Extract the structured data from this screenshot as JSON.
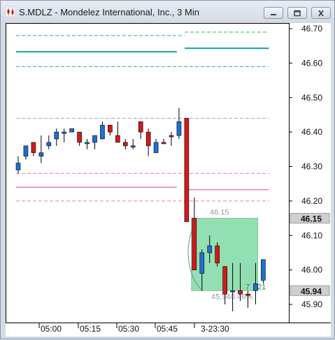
{
  "window": {
    "title": "S.MDLZ - Mondelez International, Inc., 3 Min",
    "icon": "candlestick-chart-icon",
    "buttons": [
      "minimize-icon",
      "maximize-icon",
      "close-icon"
    ]
  },
  "chart_data": {
    "type": "candlestick",
    "title": "S.MDLZ - Mondelez International, Inc., 3 Min",
    "y_ticks": [
      "46.70",
      "46.60",
      "46.50",
      "46.40",
      "46.30",
      "46.20",
      "46.10",
      "46.00",
      "45.90"
    ],
    "ylim": [
      45.86,
      46.72
    ],
    "x_ticks": [
      "05:00",
      "05:15",
      "05:30",
      "05:45",
      "3-23:30"
    ],
    "price_tags": [
      {
        "value": 46.15,
        "label": "46.15"
      },
      {
        "value": 45.94,
        "label": "45.94"
      }
    ],
    "candles": [
      {
        "t": 0,
        "o": 46.29,
        "h": 46.33,
        "l": 46.28,
        "c": 46.31,
        "color": "blue"
      },
      {
        "t": 1,
        "o": 46.33,
        "h": 46.36,
        "l": 46.32,
        "c": 46.36,
        "color": "blue"
      },
      {
        "t": 2,
        "o": 46.37,
        "h": 46.37,
        "l": 46.33,
        "c": 46.34,
        "color": "red"
      },
      {
        "t": 3,
        "o": 46.33,
        "h": 46.39,
        "l": 46.31,
        "c": 46.34,
        "color": "blue"
      },
      {
        "t": 4,
        "o": 46.36,
        "h": 46.39,
        "l": 46.35,
        "c": 46.37,
        "color": "blue"
      },
      {
        "t": 5,
        "o": 46.38,
        "h": 46.41,
        "l": 46.36,
        "c": 46.4,
        "color": "blue"
      },
      {
        "t": 6,
        "o": 46.4,
        "h": 46.41,
        "l": 46.37,
        "c": 46.4,
        "color": "blue"
      },
      {
        "t": 7,
        "o": 46.41,
        "h": 46.41,
        "l": 46.4,
        "c": 46.4,
        "color": "blue"
      },
      {
        "t": 8,
        "o": 46.4,
        "h": 46.4,
        "l": 46.36,
        "c": 46.37,
        "color": "red"
      },
      {
        "t": 9,
        "o": 46.37,
        "h": 46.38,
        "l": 46.35,
        "c": 46.37,
        "color": "blue"
      },
      {
        "t": 10,
        "o": 46.37,
        "h": 46.39,
        "l": 46.35,
        "c": 46.39,
        "color": "blue"
      },
      {
        "t": 11,
        "o": 46.38,
        "h": 46.43,
        "l": 46.38,
        "c": 46.42,
        "color": "blue"
      },
      {
        "t": 12,
        "o": 46.42,
        "h": 46.42,
        "l": 46.39,
        "c": 46.4,
        "color": "red"
      },
      {
        "t": 13,
        "o": 46.39,
        "h": 46.43,
        "l": 46.37,
        "c": 46.37,
        "color": "red"
      },
      {
        "t": 14,
        "o": 46.37,
        "h": 46.38,
        "l": 46.35,
        "c": 46.36,
        "color": "red"
      },
      {
        "t": 15,
        "o": 46.36,
        "h": 46.38,
        "l": 46.35,
        "c": 46.36,
        "color": "blue"
      },
      {
        "t": 16,
        "o": 46.43,
        "h": 46.43,
        "l": 46.38,
        "c": 46.4,
        "color": "red"
      },
      {
        "t": 17,
        "o": 46.4,
        "h": 46.41,
        "l": 46.33,
        "c": 46.36,
        "color": "red"
      },
      {
        "t": 18,
        "o": 46.34,
        "h": 46.38,
        "l": 46.34,
        "c": 46.37,
        "color": "blue"
      },
      {
        "t": 19,
        "o": 46.37,
        "h": 46.38,
        "l": 46.37,
        "c": 46.37,
        "color": "red"
      },
      {
        "t": 20,
        "o": 46.39,
        "h": 46.4,
        "l": 46.36,
        "c": 46.39,
        "color": "red"
      },
      {
        "t": 21,
        "o": 46.39,
        "h": 46.47,
        "l": 46.38,
        "c": 46.43,
        "color": "blue"
      },
      {
        "t": 22,
        "o": 46.44,
        "h": 46.44,
        "l": 46.14,
        "c": 46.14,
        "color": "red"
      },
      {
        "t": 23,
        "o": 46.15,
        "h": 46.21,
        "l": 46.0,
        "c": 46.0,
        "color": "red"
      },
      {
        "t": 24,
        "o": 45.99,
        "h": 46.06,
        "l": 45.94,
        "c": 46.05,
        "color": "blue"
      },
      {
        "t": 25,
        "o": 46.05,
        "h": 46.1,
        "l": 46.02,
        "c": 46.07,
        "color": "blue"
      },
      {
        "t": 26,
        "o": 46.07,
        "h": 46.08,
        "l": 46.01,
        "c": 46.02,
        "color": "red"
      },
      {
        "t": 27,
        "o": 46.01,
        "h": 46.01,
        "l": 45.9,
        "c": 45.93,
        "color": "red"
      },
      {
        "t": 28,
        "o": 45.94,
        "h": 46.02,
        "l": 45.88,
        "c": 45.94,
        "color": "blue"
      },
      {
        "t": 29,
        "o": 45.94,
        "h": 46.02,
        "l": 45.91,
        "c": 45.93,
        "color": "red"
      },
      {
        "t": 30,
        "o": 45.93,
        "h": 45.94,
        "l": 45.89,
        "c": 45.93,
        "color": "red"
      },
      {
        "t": 31,
        "o": 45.94,
        "h": 46.02,
        "l": 45.9,
        "c": 45.96,
        "color": "blue"
      },
      {
        "t": 32,
        "o": 45.97,
        "h": 46.03,
        "l": 45.96,
        "c": 46.03,
        "color": "blue"
      }
    ],
    "bands": {
      "green_outer_upper": [
        {
          "t0": 0,
          "t1": 22,
          "v": 46.68
        },
        {
          "t0": 22,
          "t1": 33,
          "v": 46.69
        }
      ],
      "green_center": [
        {
          "t0": 0,
          "t1": 21,
          "v": 46.633
        },
        {
          "t0": 22,
          "t1": 33,
          "v": 46.643
        }
      ],
      "green_outer_lower": [
        {
          "t0": 0,
          "t1": 33,
          "v": 46.59
        }
      ],
      "gray_level": [
        {
          "t0": 0,
          "t1": 33,
          "v": 46.44
        }
      ],
      "pink_outer_upper": [
        {
          "t0": 0,
          "t1": 33,
          "v": 46.28
        }
      ],
      "pink_center": [
        {
          "t0": 0,
          "t1": 21,
          "v": 46.24
        },
        {
          "t0": 22,
          "t1": 33,
          "v": 46.233
        }
      ],
      "pink_outer_lower": [
        {
          "t0": 0,
          "t1": 33,
          "v": 46.2
        }
      ]
    },
    "annotation_box": {
      "t0": 23,
      "t1": 31,
      "top": 46.15,
      "bottom": 45.94,
      "top_label": "46.15",
      "bottom_label": "45.94",
      "pct_label": "0.46%",
      "count_label": "7",
      "duration_label": "21"
    },
    "colors": {
      "up": "#1f6fd1",
      "down": "#d21a1a",
      "green_band": "#1fbf5f",
      "teal_line": "#15a3a3",
      "pink_band": "#f27ab0",
      "gray_band": "#a8a8a8",
      "box_fill": "#6dd49a"
    }
  }
}
